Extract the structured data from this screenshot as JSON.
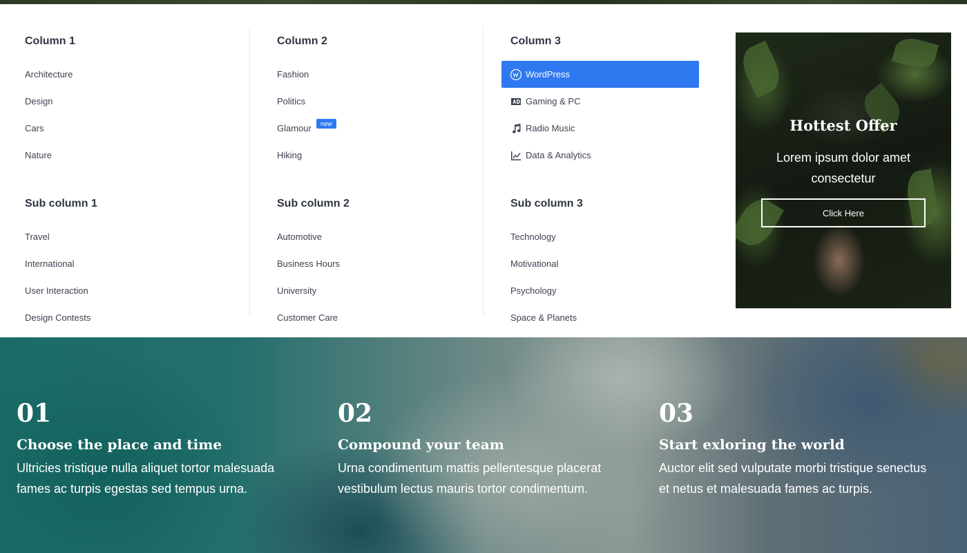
{
  "menu": {
    "column1": {
      "heading": "Column 1",
      "items": [
        "Architecture",
        "Design",
        "Cars",
        "Nature"
      ],
      "sub_heading": "Sub column 1",
      "sub_items": [
        "Travel",
        "International",
        "User Interaction",
        "Design Contests"
      ]
    },
    "column2": {
      "heading": "Column 2",
      "items": [
        "Fashion",
        "Politics",
        "Glamour",
        "Hiking"
      ],
      "badge": "new",
      "sub_heading": "Sub column 2",
      "sub_items": [
        "Automotive",
        "Business Hours",
        "University",
        "Customer Care"
      ]
    },
    "column3": {
      "heading": "Column 3",
      "items": [
        {
          "label": "WordPress",
          "icon": "wordpress-icon",
          "active": true
        },
        {
          "label": "Gaming & PC",
          "icon": "ad-icon"
        },
        {
          "label": "Radio Music",
          "icon": "music-icon"
        },
        {
          "label": "Data & Analytics",
          "icon": "chart-line-icon"
        }
      ],
      "sub_heading": "Sub column 3",
      "sub_items": [
        "Technology",
        "Motivational",
        "Psychology",
        "Space & Planets"
      ]
    }
  },
  "promo": {
    "title": "Hottest Offer",
    "text": "Lorem ipsum dolor amet consectetur",
    "button": "Click Here"
  },
  "steps": [
    {
      "num": "01",
      "title": "Choose the place and time",
      "text": "Ultricies tristique nulla aliquet tortor malesuada fames ac turpis egestas sed tempus urna."
    },
    {
      "num": "02",
      "title": "Compound your team",
      "text": "Urna condimentum mattis pellentesque placerat vestibulum lectus mauris tortor condimentum."
    },
    {
      "num": "03",
      "title": "Start exloring the world",
      "text": "Auctor elit sed vulputate morbi tristique senectus et netus et malesuada fames ac turpis."
    }
  ],
  "colors": {
    "accent": "#2e78f0",
    "heading": "#2f3542",
    "text": "#3d4250"
  }
}
